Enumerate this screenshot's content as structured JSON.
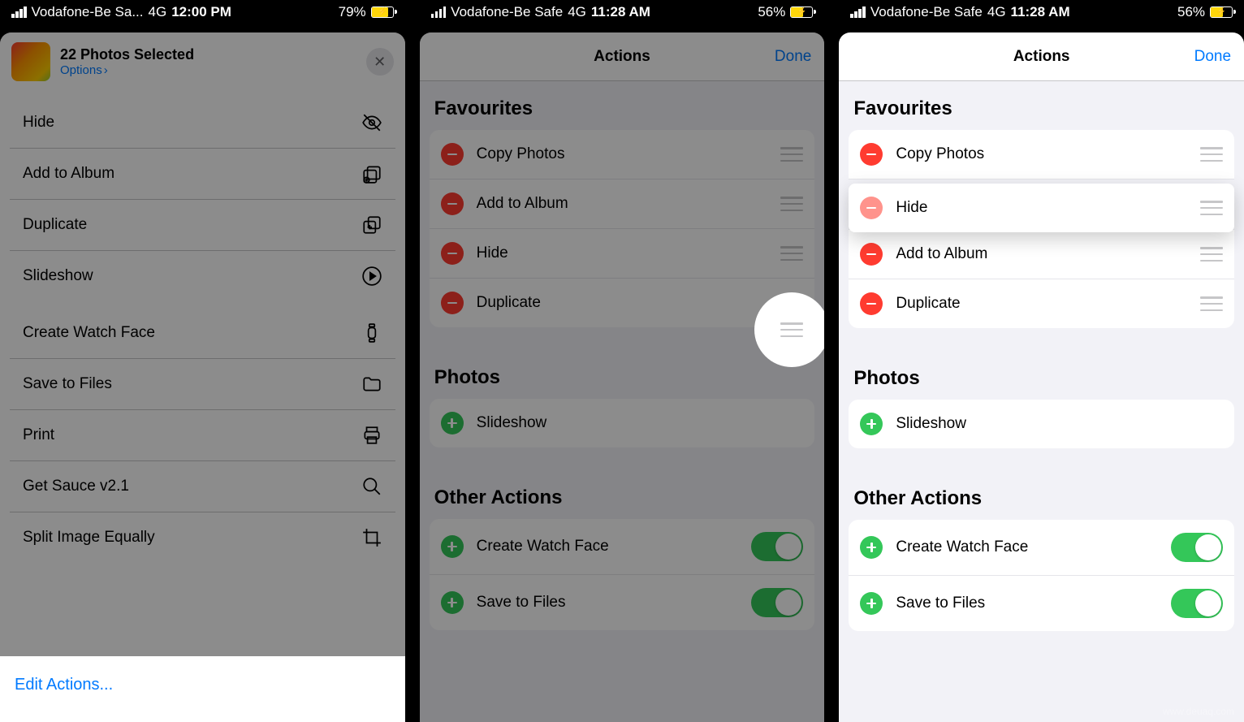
{
  "watermark": "www.deuaq.com",
  "screen1": {
    "status": {
      "carrier": "Vodafone-Be Sa...",
      "network": "4G",
      "time": "12:00 PM",
      "battery_pct": "79%"
    },
    "share_title": "22 Photos Selected",
    "options_label": "Options",
    "actions": [
      {
        "label": "Hide",
        "icon": "eye-slash-icon"
      },
      {
        "label": "Add to Album",
        "icon": "album-add-icon"
      },
      {
        "label": "Duplicate",
        "icon": "duplicate-icon"
      },
      {
        "label": "Slideshow",
        "icon": "play-circle-icon"
      }
    ],
    "actions2": [
      {
        "label": "Create Watch Face",
        "icon": "watch-icon"
      },
      {
        "label": "Save to Files",
        "icon": "folder-icon"
      },
      {
        "label": "Print",
        "icon": "printer-icon"
      },
      {
        "label": "Get Sauce v2.1",
        "icon": "search-icon"
      },
      {
        "label": "Split Image Equally",
        "icon": "crop-icon"
      }
    ],
    "edit_actions": "Edit Actions..."
  },
  "screen2": {
    "status": {
      "carrier": "Vodafone-Be Safe",
      "network": "4G",
      "time": "11:28 AM",
      "battery_pct": "56%"
    },
    "title": "Actions",
    "done": "Done",
    "favourites_header": "Favourites",
    "favourites": [
      {
        "label": "Copy Photos"
      },
      {
        "label": "Add to Album"
      },
      {
        "label": "Hide"
      },
      {
        "label": "Duplicate"
      }
    ],
    "photos_header": "Photos",
    "photos": [
      {
        "label": "Slideshow"
      }
    ],
    "other_header": "Other Actions",
    "other": [
      {
        "label": "Create Watch Face"
      },
      {
        "label": "Save to Files"
      }
    ]
  },
  "screen3": {
    "status": {
      "carrier": "Vodafone-Be Safe",
      "network": "4G",
      "time": "11:28 AM",
      "battery_pct": "56%"
    },
    "title": "Actions",
    "done": "Done",
    "favourites_header": "Favourites",
    "favourites": [
      {
        "label": "Copy Photos"
      },
      {
        "label": "Hide"
      },
      {
        "label": "Add to Album"
      },
      {
        "label": "Duplicate"
      }
    ],
    "photos_header": "Photos",
    "photos": [
      {
        "label": "Slideshow"
      }
    ],
    "other_header": "Other Actions",
    "other": [
      {
        "label": "Create Watch Face"
      },
      {
        "label": "Save to Files"
      }
    ]
  }
}
